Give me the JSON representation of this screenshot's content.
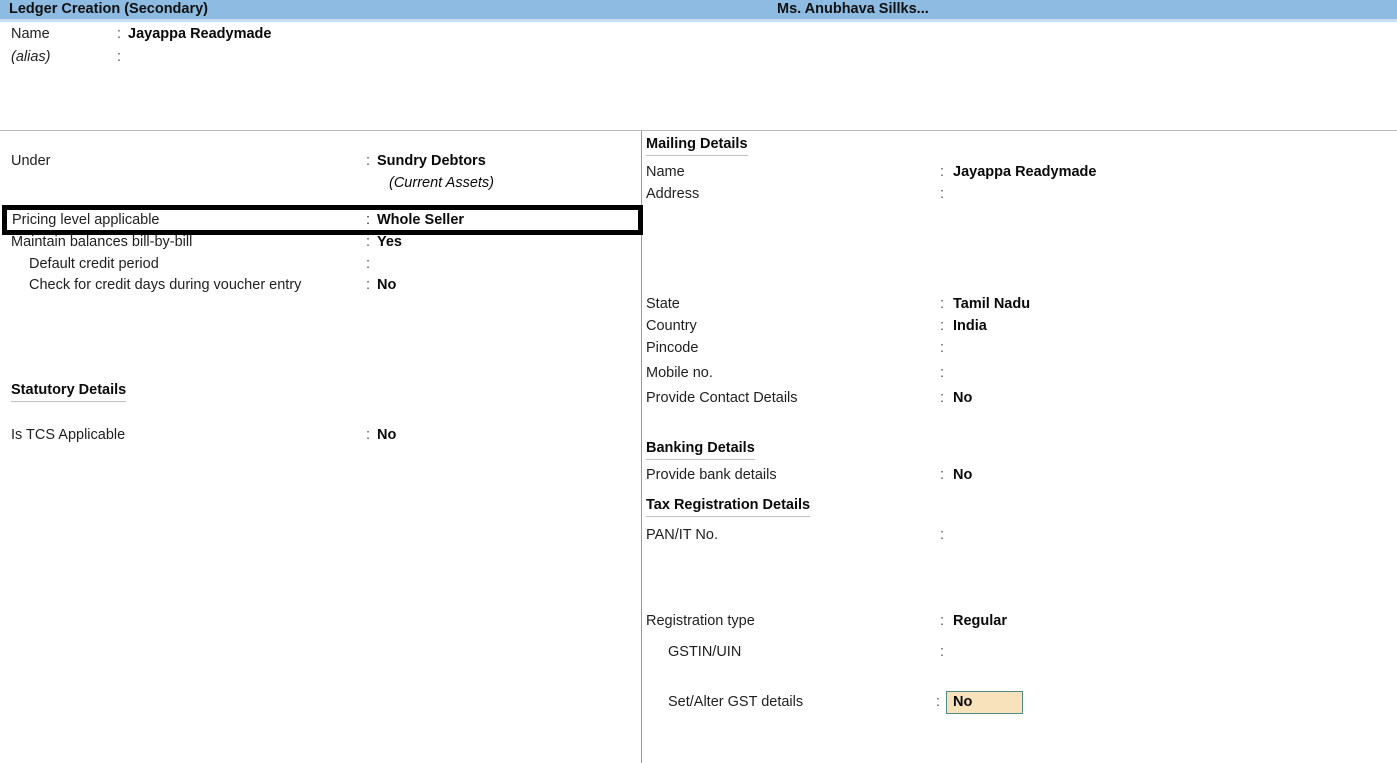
{
  "window": {
    "title": "Ledger Creation (Secondary)",
    "company": "Ms. Anubhava Sillks...",
    "header_color": "#8dbbe1"
  },
  "top": {
    "name_label": "Name",
    "name_colon": ":",
    "name_value": "Jayappa Readymade",
    "alias_label": "(alias)",
    "alias_colon": ":",
    "alias_value": ""
  },
  "left_panel": {
    "under": {
      "label": "Under",
      "colon": ":",
      "value": "Sundry Debtors",
      "sub_value": "(Current Assets)"
    },
    "pricing_level": {
      "label": "Pricing level applicable",
      "colon": ":",
      "value": "Whole Seller",
      "selected": true
    },
    "maintain_bill_by_bill": {
      "label": "Maintain balances bill-by-bill",
      "colon": ":",
      "value": "Yes"
    },
    "default_credit_period": {
      "label": "Default credit period",
      "colon": ":",
      "value": ""
    },
    "check_credit_days": {
      "label": "Check for credit days during voucher entry",
      "colon": ":",
      "value": "No"
    },
    "statutory_heading": "Statutory Details",
    "is_tcs_applicable": {
      "label": "Is TCS Applicable",
      "colon": ":",
      "value": "No"
    }
  },
  "right_panel": {
    "mailing_heading": "Mailing Details",
    "mailing_name": {
      "label": "Name",
      "colon": ":",
      "value": "Jayappa Readymade"
    },
    "mailing_address": {
      "label": "Address",
      "colon": ":",
      "value": ""
    },
    "state": {
      "label": "State",
      "colon": ":",
      "value": "Tamil Nadu"
    },
    "country": {
      "label": "Country",
      "colon": ":",
      "value": "India"
    },
    "pincode": {
      "label": "Pincode",
      "colon": ":",
      "value": ""
    },
    "mobile_no": {
      "label": "Mobile no.",
      "colon": ":",
      "value": ""
    },
    "provide_contact_details": {
      "label": "Provide Contact Details",
      "colon": ":",
      "value": "No"
    },
    "banking_heading": "Banking Details",
    "provide_bank_details": {
      "label": "Provide bank details",
      "colon": ":",
      "value": "No"
    },
    "tax_heading": "Tax Registration Details",
    "pan_it_no": {
      "label": "PAN/IT No.",
      "colon": ":",
      "value": ""
    },
    "registration_type": {
      "label": "Registration type",
      "colon": ":",
      "value": "Regular"
    },
    "gstin_uin": {
      "label": "GSTIN/UIN",
      "colon": ":",
      "value": ""
    },
    "set_alter_gst": {
      "label": "Set/Alter GST details",
      "colon": ":",
      "value": "No",
      "field_bg": "#f7e2bb",
      "field_border": "#4f8a86"
    }
  }
}
